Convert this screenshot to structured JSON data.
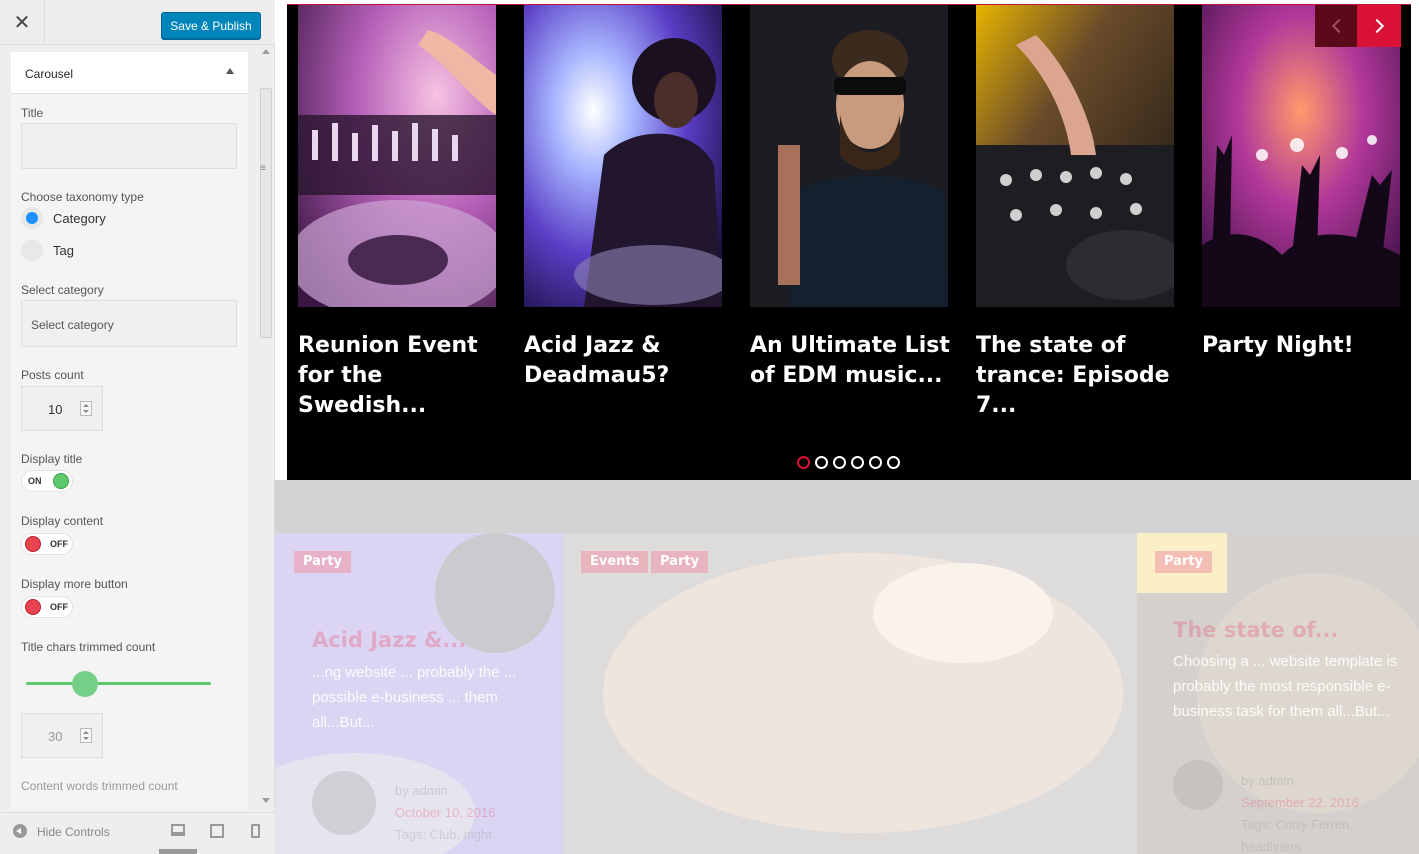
{
  "customizer": {
    "close_icon": "close-icon",
    "publish_label": "Save & Publish",
    "section_title": "Carousel",
    "title_label": "Title",
    "title_value": "",
    "taxonomy_label": "Choose taxonomy type",
    "taxonomy_options": [
      "Category",
      "Tag"
    ],
    "taxonomy_selected": "Category",
    "category_label": "Select category",
    "category_placeholder": "Select category",
    "posts_count_label": "Posts count",
    "posts_count_value": "10",
    "display_title_label": "Display title",
    "display_title_state": "ON",
    "display_content_label": "Display content",
    "display_content_state": "OFF",
    "display_more_label": "Display more button",
    "display_more_state": "OFF",
    "title_chars_label": "Title chars trimmed count",
    "title_chars_fraction": 0.3,
    "title_chars_value": "30",
    "content_words_label": "Content words trimmed count",
    "hide_controls_label": "Hide Controls",
    "colors": {
      "primary": "#0085ba",
      "toggle_on": "#5cc96b",
      "toggle_off": "#e9434f",
      "radio": "#1e90ff"
    }
  },
  "carousel": {
    "slides": [
      {
        "title": "Reunion Event for the Swedish..."
      },
      {
        "title": "Acid Jazz & Deadmau5?"
      },
      {
        "title": "An Ultimate List of EDM music..."
      },
      {
        "title": "The state of trance: Episode 7..."
      },
      {
        "title": "Party Night!"
      }
    ],
    "dot_count": 6,
    "active_dot": 0,
    "accent": "#d91136"
  },
  "posts": [
    {
      "tags": [
        "Party"
      ],
      "title": "Acid Jazz &...",
      "excerpt": "...ng website ... probably the ... possible e-business ... them all...But...",
      "author": "by admin",
      "date": "October 10, 2016",
      "tags_line": "Tags: Club, night"
    },
    {
      "tags": [
        "Events",
        "Party"
      ]
    },
    {
      "tags": [
        "Party"
      ],
      "title": "The state of...",
      "excerpt": "Choosing a ... website template is probably the most responsible e-business task for them all...But...",
      "author": "by admin",
      "date": "September 22, 2016",
      "tags_line": "Tags: Corry Ferren, headliners"
    }
  ]
}
